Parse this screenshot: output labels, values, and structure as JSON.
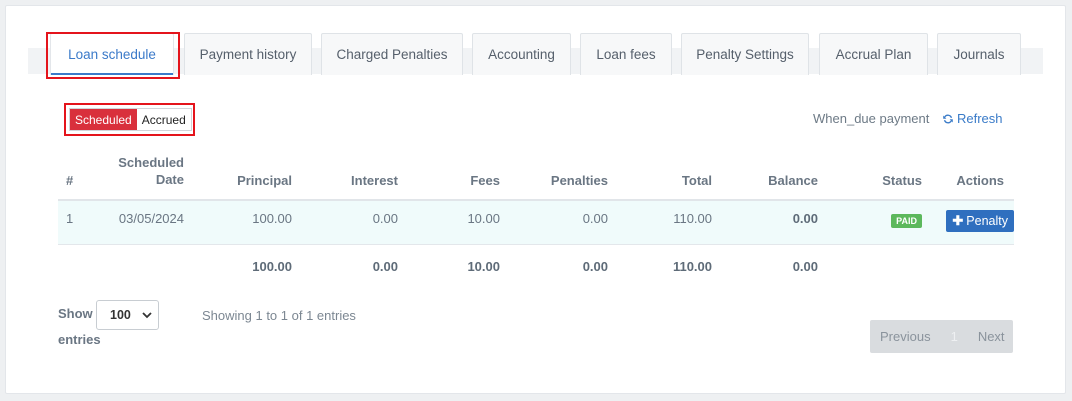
{
  "tabs": [
    {
      "label": "Loan schedule",
      "active": true
    },
    {
      "label": "Payment history"
    },
    {
      "label": "Charged Penalties"
    },
    {
      "label": "Accounting"
    },
    {
      "label": "Loan fees"
    },
    {
      "label": "Penalty Settings"
    },
    {
      "label": "Accrual Plan"
    },
    {
      "label": "Journals"
    }
  ],
  "toggle": {
    "scheduled": "Scheduled",
    "accrued": "Accrued",
    "selected": "Scheduled"
  },
  "when_due": "When_due payment",
  "refresh": "Refresh",
  "table": {
    "headers": {
      "num": "#",
      "date_line1": "Scheduled",
      "date_line2": "Date",
      "principal": "Principal",
      "interest": "Interest",
      "fees": "Fees",
      "penalties": "Penalties",
      "total": "Total",
      "balance": "Balance",
      "status": "Status",
      "actions": "Actions"
    },
    "rows": [
      {
        "num": "1",
        "date": "03/05/2024",
        "principal": "100.00",
        "interest": "0.00",
        "fees": "10.00",
        "penalties": "0.00",
        "total": "110.00",
        "balance": "0.00",
        "status": "PAID",
        "action": "Penalty"
      }
    ],
    "totals": {
      "principal": "100.00",
      "interest": "0.00",
      "fees": "10.00",
      "penalties": "0.00",
      "total": "110.00",
      "balance": "0.00"
    }
  },
  "footer": {
    "show_label": "Show",
    "entries_label": "entries",
    "page_size": "100",
    "showing_text": "Showing 1 to 1 of 1 entries",
    "previous": "Previous",
    "page": "1",
    "next": "Next"
  },
  "colors": {
    "accent": "#3b7ac9",
    "danger": "#d9303c",
    "success": "#5cb85c",
    "highlight": "#e4141c"
  }
}
